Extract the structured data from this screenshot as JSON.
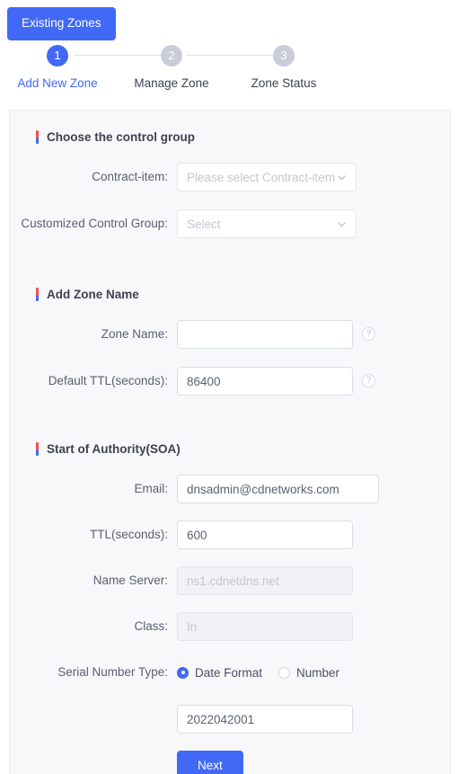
{
  "header": {
    "existing_zones_button": "Existing Zones"
  },
  "steps": [
    {
      "number": "1",
      "label": "Add New Zone",
      "state": "active"
    },
    {
      "number": "2",
      "label": "Manage Zone",
      "state": "inactive"
    },
    {
      "number": "3",
      "label": "Zone Status",
      "state": "inactive"
    }
  ],
  "sections": {
    "control_group": {
      "title": "Choose the control group",
      "contract_item": {
        "label": "Contract-item:",
        "placeholder": "Please select Contract-item",
        "value": ""
      },
      "customized_control_group": {
        "label": "Customized Control Group:",
        "placeholder": "Select",
        "value": ""
      }
    },
    "zone_name": {
      "title": "Add Zone Name",
      "zone_name": {
        "label": "Zone Name:",
        "value": "",
        "help": "?"
      },
      "default_ttl": {
        "label": "Default TTL(seconds):",
        "value": "86400",
        "help": "?"
      }
    },
    "soa": {
      "title": "Start of Authority(SOA)",
      "email": {
        "label": "Email:",
        "value": "dnsadmin@cdnetworks.com"
      },
      "ttl": {
        "label": "TTL(seconds):",
        "value": "600"
      },
      "name_server": {
        "label": "Name Server:",
        "value": "ns1.cdnetdns.net",
        "disabled": "true"
      },
      "class": {
        "label": "Class:",
        "value": "In",
        "disabled": "true"
      },
      "serial_number_type": {
        "label": "Serial Number Type:",
        "options": [
          {
            "label": "Date Format",
            "selected": "true"
          },
          {
            "label": "Number",
            "selected": "false"
          }
        ]
      },
      "serial_number": {
        "value": "2022042001"
      }
    }
  },
  "footer": {
    "next_button": "Next"
  },
  "colors": {
    "accent_blue": "#4169f5",
    "accent_red": "#f5504e",
    "panel_bg": "#f7f8fa",
    "inactive_grey": "#c9cdd9"
  }
}
